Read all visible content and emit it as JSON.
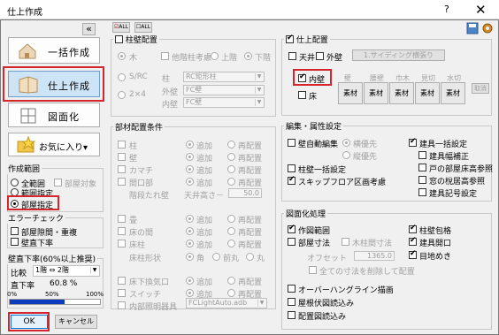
{
  "window": {
    "title": "仕上作成",
    "help": "?",
    "close": "✕"
  },
  "toolbar": {
    "collapse": "«",
    "top_btn1": "ALL",
    "top_btn2": "ALL"
  },
  "left_buttons": [
    {
      "label": "一括作成"
    },
    {
      "label": "仕上作成"
    },
    {
      "label": "図面化"
    },
    {
      "label": "お気に入り▾"
    }
  ],
  "sakusei_hani": {
    "title": "作成範囲",
    "options": [
      "全範囲",
      "範囲指定",
      "部屋指定"
    ],
    "check_label": "部屋対象"
  },
  "error_check": {
    "title": "エラーチェック",
    "items": [
      "部屋隙間・重複",
      "壁直下率"
    ]
  },
  "wall_ratio": {
    "title": "壁直下率(60%以上推奨)",
    "compare_label": "比較",
    "compare_value": "1階 ⇔ 2階",
    "ratio_label": "直下率",
    "ratio_value": "60.8 %",
    "scale": [
      "0%",
      "50%",
      "100%"
    ],
    "fill_fraction": 0.608
  },
  "bottom": {
    "ok": "OK",
    "cancel": "キャンセル"
  },
  "hashira": {
    "title": "柱壁配置",
    "row1": {
      "r1": "木",
      "c1": "他階柱考慮",
      "r2": "上階",
      "r3": "下階"
    },
    "r_src": "S/RC",
    "r_2x4": "2×4",
    "label_hashira": "柱",
    "label_gaiheki": "外壁",
    "label_naiheki": "内壁",
    "val_hashira": "RC矩形柱",
    "val_gaiheki": "FC壁",
    "val_naiheki": "FC壁"
  },
  "buzai": {
    "title": "部材配置条件",
    "items": [
      "柱",
      "壁",
      "カマチ",
      "間口部",
      "畳",
      "床の間",
      "床柱",
      "床下換気口",
      "スイッチ",
      "内部照明器具"
    ],
    "add": "追加",
    "replace": "再配置",
    "tarekabe": "階段たれ壁",
    "tenjo": "天井高さ－",
    "tenjo_val": "50.0",
    "tokobashira_shape": "床柱形状",
    "shape_opts": [
      "角",
      "前丸",
      "丸"
    ],
    "light_val": "FCLightAuto.adb"
  },
  "shiage": {
    "title": "仕上配置",
    "tenjo": "天井",
    "gaiheki": "外壁",
    "siding_btn": "1.サイディング横張り",
    "naiheki": "内壁",
    "yuka": "床",
    "columns": [
      "壁",
      "腰壁",
      "巾木",
      "見切",
      "水切"
    ],
    "sozai": "素材",
    "cancel": "取消"
  },
  "henshu": {
    "title": "編集・属性設定",
    "kabe_auto": "壁自動編集",
    "yoko": "横優先",
    "tate": "縦優先",
    "hashira_kabe": "柱壁一括設定",
    "skip": "スキップフロア区画考慮",
    "right": [
      "建具一括設定",
      "建具幅補正",
      "戸の部屋床高参照",
      "窓の梲居高参照",
      "建具記号設定"
    ]
  },
  "zumen": {
    "title": "図面化処理",
    "sakuzu": "作図範囲",
    "heya_sunpo": "部屋寸法",
    "mokuchu": "木柱間寸法",
    "offset_label": "オフセット",
    "offset_val": "1365.0",
    "delete_all": "全ての寸法を削除して配置",
    "right": [
      "柱壁包格",
      "建具開口",
      "目地めき"
    ],
    "overhang": "オーバーハングライン描画",
    "yane": "屋根伏図読込み",
    "haichi": "配置図読込み"
  }
}
